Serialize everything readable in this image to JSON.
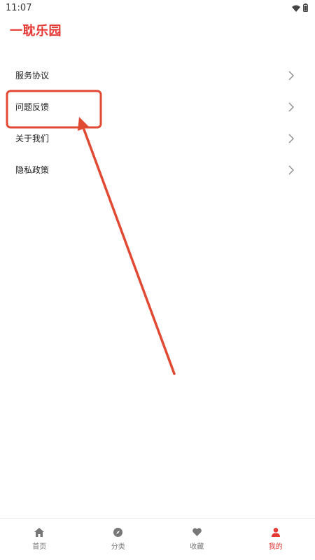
{
  "status_bar": {
    "time": "11:07",
    "icons": [
      "wifi-icon",
      "battery-icon"
    ]
  },
  "header": {
    "title": "一耽乐园"
  },
  "menu": {
    "items": [
      {
        "label": "服务协议",
        "icon": "chevron-right-icon"
      },
      {
        "label": "问题反馈",
        "icon": "chevron-right-icon"
      },
      {
        "label": "关于我们",
        "icon": "chevron-right-icon"
      },
      {
        "label": "隐私政策",
        "icon": "chevron-right-icon"
      }
    ]
  },
  "annotation": {
    "color": "#e04a33",
    "highlighted_item": "问题反馈"
  },
  "tab_bar": {
    "tabs": [
      {
        "label": "首页",
        "icon": "home-icon",
        "active": false
      },
      {
        "label": "分类",
        "icon": "compass-icon",
        "active": false
      },
      {
        "label": "收藏",
        "icon": "heart-icon",
        "active": false
      },
      {
        "label": "我的",
        "icon": "user-icon",
        "active": true
      }
    ]
  },
  "colors": {
    "accent": "#e53935",
    "inactive": "#777777",
    "text": "#222222"
  }
}
